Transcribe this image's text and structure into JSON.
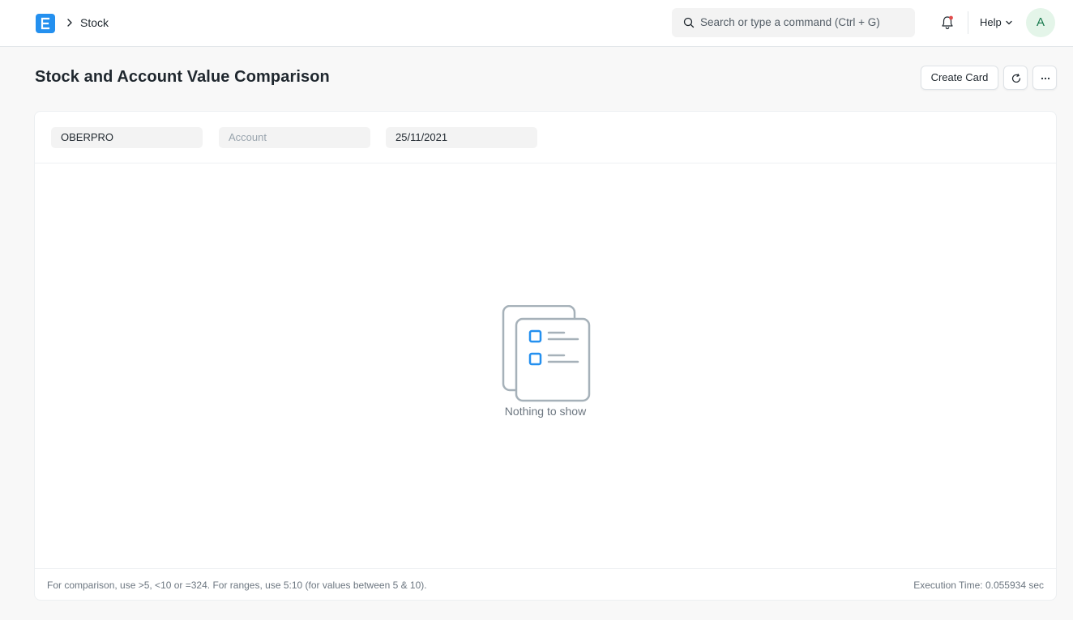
{
  "navbar": {
    "logo_letter": "E",
    "breadcrumb": "Stock",
    "search_placeholder": "Search or type a command (Ctrl + G)",
    "help_label": "Help",
    "avatar_initial": "A",
    "notification_dot_color": "#e24c4c"
  },
  "page": {
    "title": "Stock and Account Value Comparison",
    "create_card_label": "Create Card"
  },
  "filters": {
    "company": "OBERPRO",
    "account_placeholder": "Account",
    "as_on_date": "25/11/2021"
  },
  "report": {
    "empty_message": "Nothing to show",
    "hint": "For comparison, use >5, <10 or =324. For ranges, use 5:10 (for values between 5 & 10).",
    "execution_time": "Execution Time: 0.055934 sec"
  },
  "colors": {
    "accent": "#2490ef",
    "avatar_bg": "#e4f5e9",
    "avatar_fg": "#16794c"
  }
}
